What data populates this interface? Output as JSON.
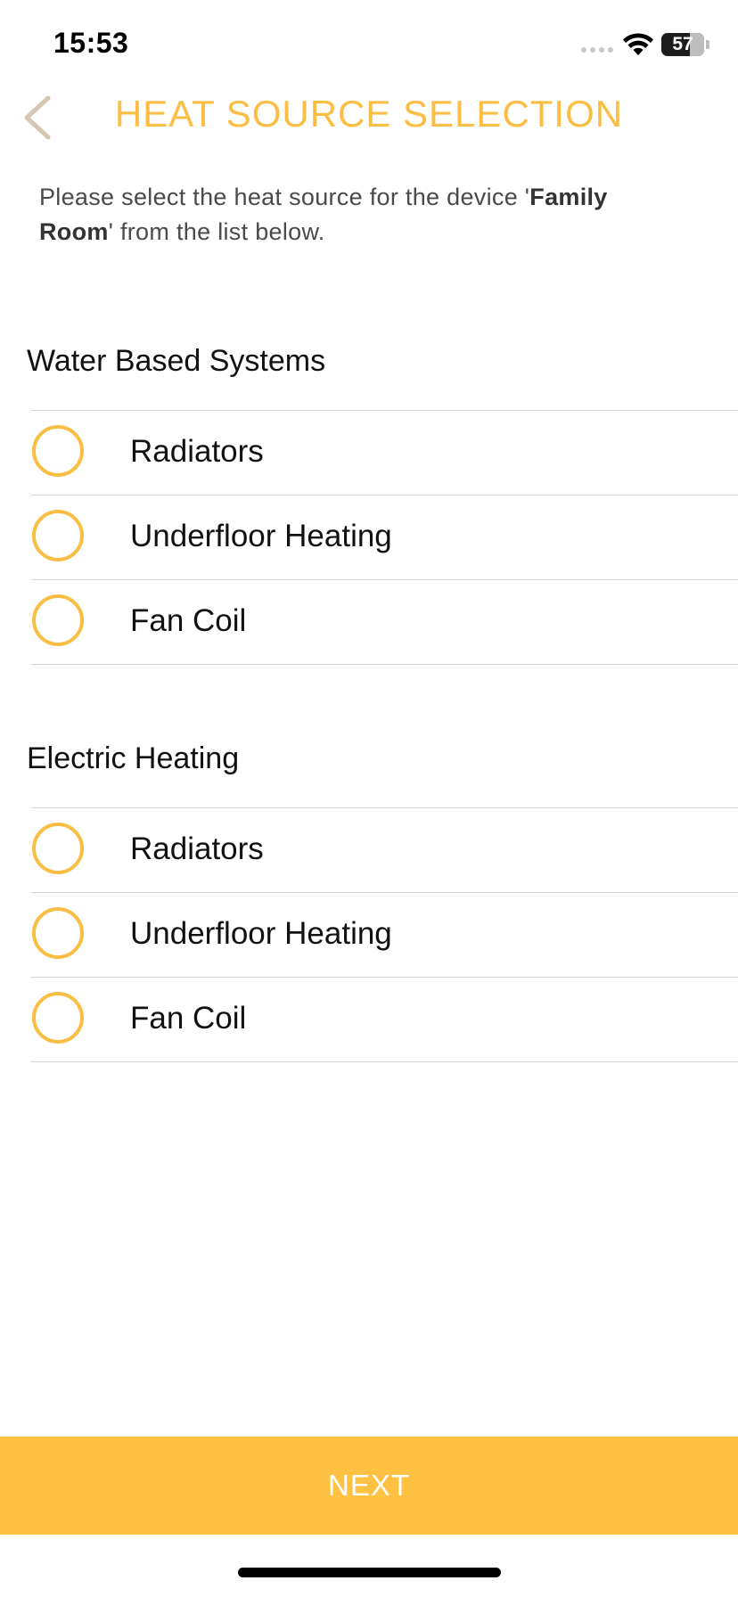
{
  "status_bar": {
    "time": "15:53",
    "battery": "57"
  },
  "header": {
    "title": "HEAT SOURCE SELECTION",
    "back_icon": "chevron-left-icon"
  },
  "description": {
    "prefix": "Please select the heat source for the device '",
    "device_name": "Family Room",
    "suffix": "' from the list below."
  },
  "sections": [
    {
      "title": "Water Based Systems",
      "options": [
        {
          "label": "Radiators",
          "selected": false
        },
        {
          "label": "Underfloor Heating",
          "selected": false
        },
        {
          "label": "Fan Coil",
          "selected": false
        }
      ]
    },
    {
      "title": "Electric Heating",
      "options": [
        {
          "label": "Radiators",
          "selected": false
        },
        {
          "label": "Underfloor Heating",
          "selected": false
        },
        {
          "label": "Fan Coil",
          "selected": false
        }
      ]
    }
  ],
  "footer": {
    "next_label": "NEXT"
  },
  "colors": {
    "accent": "#f9be43",
    "button": "#fec142",
    "back_chevron": "#d4c7b4"
  }
}
